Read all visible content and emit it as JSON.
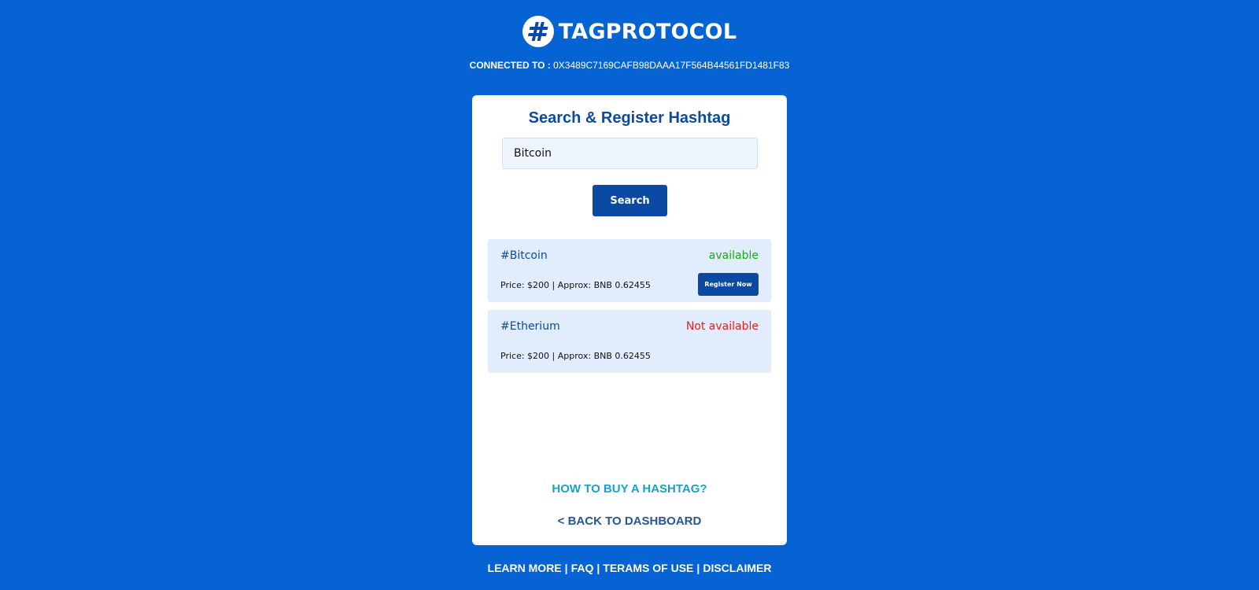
{
  "header": {
    "brand_name": "TAGPROTOCOL",
    "logo_icon": "hashtag-icon",
    "connected_label": "CONNECTED TO :",
    "connected_address": "0X3489C7169CAFB98DAAA17F564B44561FD1481F83"
  },
  "card": {
    "title": "Search & Register Hashtag",
    "search_value": "Bitcoin",
    "search_button": "Search",
    "results": [
      {
        "tag": "#Bitcoin",
        "status": "available",
        "status_color": "#1aaa1a",
        "price": "Price: $200 | Approx: BNB 0.62455",
        "action": "Register Now"
      },
      {
        "tag": "#Etherium",
        "status": "Not available",
        "status_color": "#e81f1f",
        "price": "Price: $200 | Approx: BNB 0.62455"
      }
    ],
    "how_to_link": "HOW TO BUY A HASHTAG?",
    "back_link": "< BACK TO DASHBOARD"
  },
  "footer": {
    "links": [
      "LEARN MORE",
      "FAQ",
      "TERAMS OF USE",
      "DISCLAIMER"
    ],
    "separator": "|"
  },
  "colors": {
    "background": "#0563d4",
    "primary": "#0b4aa2",
    "link_accent": "#1aa1c5"
  }
}
